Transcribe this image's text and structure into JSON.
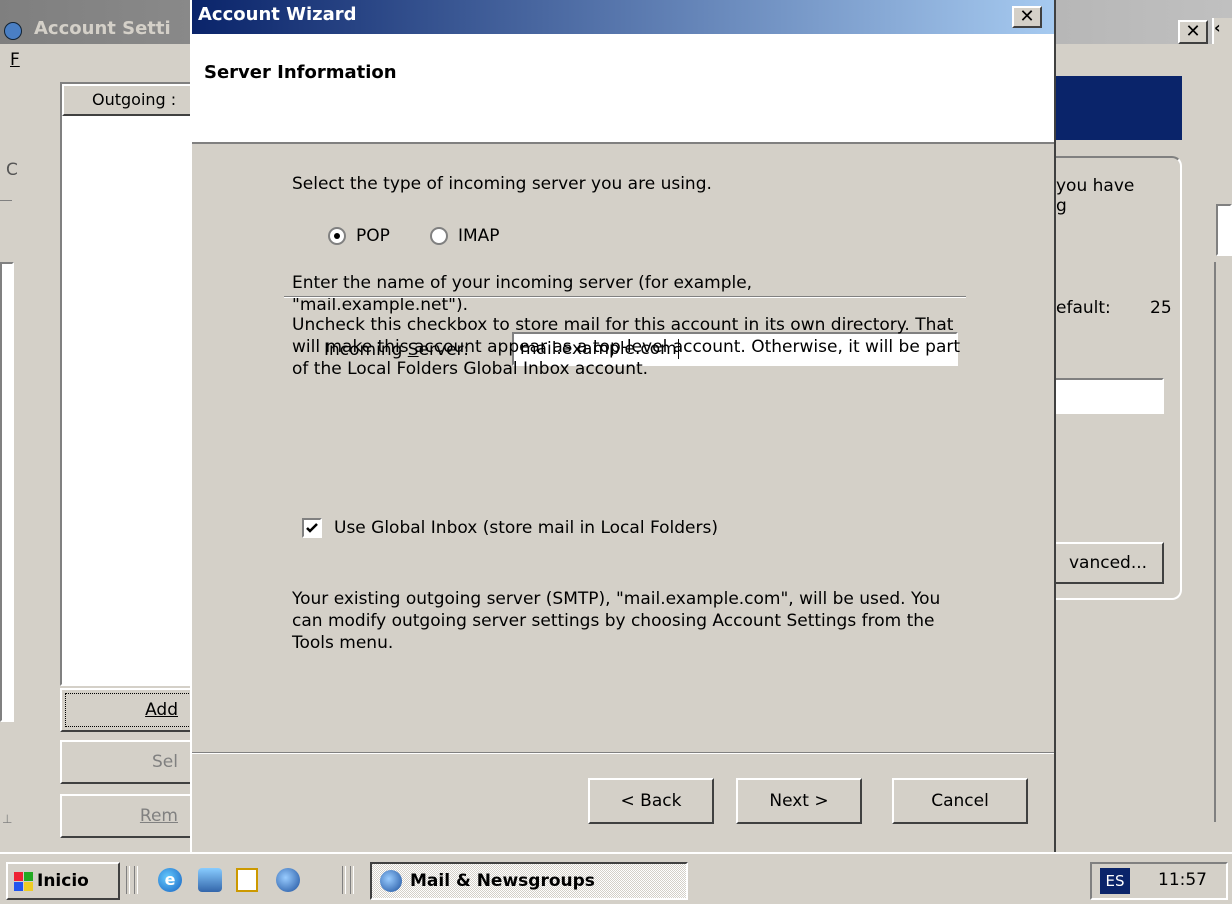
{
  "background_window": {
    "title": "Account Setti",
    "menu_letter": "F",
    "list_header": "Outgoing :",
    "left_label": "C",
    "buttons": {
      "add": "Add",
      "set": "Sel",
      "remove": "Rem"
    },
    "right_texts": {
      "line1": "you have",
      "line2": "g",
      "default": "efault:",
      "port": "25"
    },
    "advanced_button": "vanced..."
  },
  "wizard": {
    "title": "Account Wizard",
    "heading": "Server Information",
    "server_type_prompt": "Select the type of incoming server you are using.",
    "radio_pop": "POP",
    "radio_imap": "IMAP",
    "selected_type": "POP",
    "server_name_prompt": "Enter the name of your incoming server (for example, \"mail.example.net\").",
    "incoming_server_label": "Incoming Server:",
    "incoming_server_label_accesskey": "S",
    "incoming_server_value": "mail.example.com",
    "global_inbox_explanation": "Uncheck this checkbox to store mail for this account in its own directory. That will make this account appear as a top-level account. Otherwise, it will be part of the Local Folders Global Inbox account.",
    "global_inbox_checkbox_label": "Use Global Inbox (store mail in Local Folders)",
    "global_inbox_checked": true,
    "smtp_note": "Your existing outgoing server (SMTP), \"mail.example.com\", will be used. You can modify outgoing server settings by choosing Account Settings from the Tools menu.",
    "buttons": {
      "back": "< Back",
      "next": "Next >",
      "cancel": "Cancel"
    }
  },
  "taskbar": {
    "start_label": "Inicio",
    "quick_launch_icons": [
      "internet-explorer-icon",
      "outlook-express-icon",
      "notepad-icon",
      "mozilla-icon"
    ],
    "task_button": "Mail & Newsgroups",
    "language": "ES",
    "clock": "11:57"
  },
  "colors": {
    "title_active": "#0a246a",
    "face": "#d4d0c8",
    "taskbar": "#d4d0c8",
    "language_badge": "#0a246a"
  }
}
